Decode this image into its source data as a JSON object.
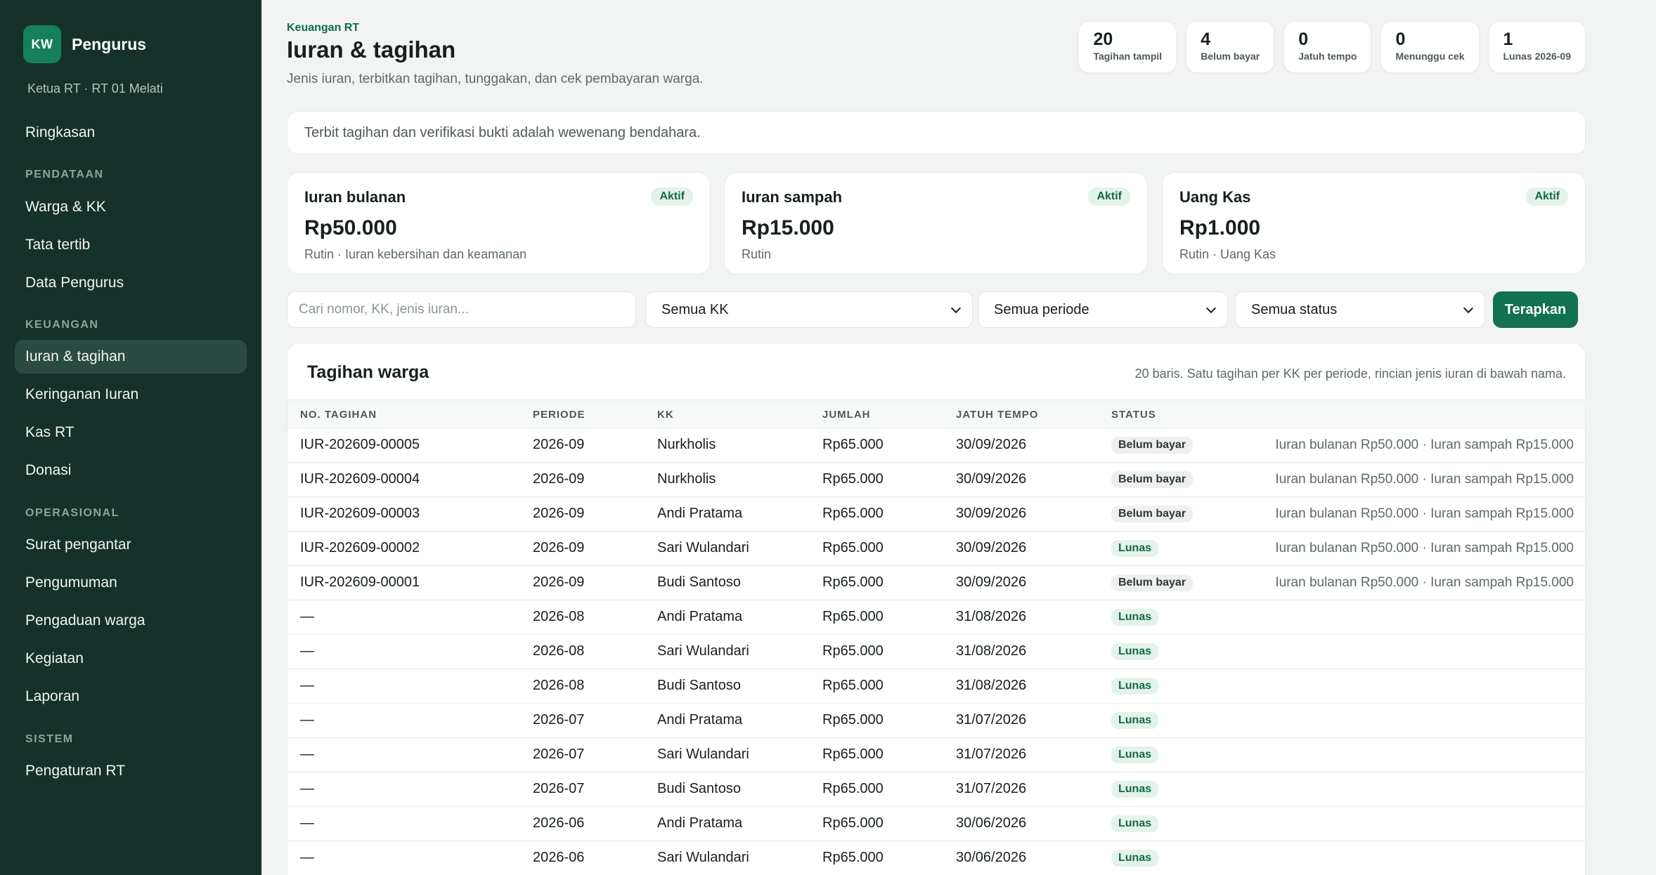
{
  "sidebar": {
    "brand_initials": "KW",
    "brand_name": "Pengurus",
    "role": "Ketua RT · RT 01 Melati",
    "summary": "Ringkasan",
    "sections": {
      "data": "PENDATAAN",
      "finance": "KEUANGAN",
      "ops": "OPERASIONAL",
      "system": "SISTEM"
    },
    "items": {
      "warga": "Warga & KK",
      "tata_tertib": "Tata tertib",
      "data_pengurus": "Data Pengurus",
      "iuran": "Iuran & tagihan",
      "keringanan": "Keringanan Iuran",
      "kas": "Kas RT",
      "donasi": "Donasi",
      "surat": "Surat pengantar",
      "pengumuman": "Pengumuman",
      "pengaduan": "Pengaduan warga",
      "kegiatan": "Kegiatan",
      "laporan": "Laporan",
      "pengaturan": "Pengaturan RT"
    }
  },
  "header": {
    "eyebrow": "Keuangan RT",
    "title": "Iuran & tagihan",
    "subtitle": "Jenis iuran, terbitkan tagihan, tunggakan, dan cek pembayaran warga."
  },
  "stats": [
    {
      "value": "20",
      "label": "Tagihan tampil"
    },
    {
      "value": "4",
      "label": "Belum bayar"
    },
    {
      "value": "0",
      "label": "Jatuh tempo"
    },
    {
      "value": "0",
      "label": "Menunggu cek"
    },
    {
      "value": "1",
      "label": "Lunas 2026-09"
    }
  ],
  "notice": "Terbit tagihan dan verifikasi bukti adalah wewenang bendahara.",
  "fee_types": [
    {
      "name": "Iuran bulanan",
      "badge": "Aktif",
      "amount": "Rp50.000",
      "desc": "Rutin · Iuran kebersihan dan keamanan"
    },
    {
      "name": "Iuran sampah",
      "badge": "Aktif",
      "amount": "Rp15.000",
      "desc": "Rutin"
    },
    {
      "name": "Uang Kas",
      "badge": "Aktif",
      "amount": "Rp1.000",
      "desc": "Rutin · Uang Kas"
    }
  ],
  "filters": {
    "search_placeholder": "Cari nomor, KK, jenis iuran...",
    "kk": "Semua KK",
    "period": "Semua periode",
    "status": "Semua status",
    "apply": "Terapkan"
  },
  "table": {
    "title": "Tagihan warga",
    "note": "20 baris. Satu tagihan per KK per periode, rincian jenis iuran di bawah nama.",
    "columns": [
      "NO. TAGIHAN",
      "PERIODE",
      "KK",
      "JUMLAH",
      "JATUH TEMPO",
      "STATUS"
    ],
    "rows": [
      {
        "no": "IUR-202609-00005",
        "period": "2026-09",
        "kk": "Nurkholis",
        "amount": "Rp65.000",
        "due": "30/09/2026",
        "status": "Belum bayar",
        "paid": false,
        "detail": "Iuran bulanan Rp50.000 · Iuran sampah Rp15.000"
      },
      {
        "no": "IUR-202609-00004",
        "period": "2026-09",
        "kk": "Nurkholis",
        "amount": "Rp65.000",
        "due": "30/09/2026",
        "status": "Belum bayar",
        "paid": false,
        "detail": "Iuran bulanan Rp50.000 · Iuran sampah Rp15.000"
      },
      {
        "no": "IUR-202609-00003",
        "period": "2026-09",
        "kk": "Andi Pratama",
        "amount": "Rp65.000",
        "due": "30/09/2026",
        "status": "Belum bayar",
        "paid": false,
        "detail": "Iuran bulanan Rp50.000 · Iuran sampah Rp15.000"
      },
      {
        "no": "IUR-202609-00002",
        "period": "2026-09",
        "kk": "Sari Wulandari",
        "amount": "Rp65.000",
        "due": "30/09/2026",
        "status": "Lunas",
        "paid": true,
        "detail": "Iuran bulanan Rp50.000 · Iuran sampah Rp15.000"
      },
      {
        "no": "IUR-202609-00001",
        "period": "2026-09",
        "kk": "Budi Santoso",
        "amount": "Rp65.000",
        "due": "30/09/2026",
        "status": "Belum bayar",
        "paid": false,
        "detail": "Iuran bulanan Rp50.000 · Iuran sampah Rp15.000"
      },
      {
        "no": "—",
        "period": "2026-08",
        "kk": "Andi Pratama",
        "amount": "Rp65.000",
        "due": "31/08/2026",
        "status": "Lunas",
        "paid": true,
        "detail": ""
      },
      {
        "no": "—",
        "period": "2026-08",
        "kk": "Sari Wulandari",
        "amount": "Rp65.000",
        "due": "31/08/2026",
        "status": "Lunas",
        "paid": true,
        "detail": ""
      },
      {
        "no": "—",
        "period": "2026-08",
        "kk": "Budi Santoso",
        "amount": "Rp65.000",
        "due": "31/08/2026",
        "status": "Lunas",
        "paid": true,
        "detail": ""
      },
      {
        "no": "—",
        "period": "2026-07",
        "kk": "Andi Pratama",
        "amount": "Rp65.000",
        "due": "31/07/2026",
        "status": "Lunas",
        "paid": true,
        "detail": ""
      },
      {
        "no": "—",
        "period": "2026-07",
        "kk": "Sari Wulandari",
        "amount": "Rp65.000",
        "due": "31/07/2026",
        "status": "Lunas",
        "paid": true,
        "detail": ""
      },
      {
        "no": "—",
        "period": "2026-07",
        "kk": "Budi Santoso",
        "amount": "Rp65.000",
        "due": "31/07/2026",
        "status": "Lunas",
        "paid": true,
        "detail": ""
      },
      {
        "no": "—",
        "period": "2026-06",
        "kk": "Andi Pratama",
        "amount": "Rp65.000",
        "due": "30/06/2026",
        "status": "Lunas",
        "paid": true,
        "detail": ""
      },
      {
        "no": "—",
        "period": "2026-06",
        "kk": "Sari Wulandari",
        "amount": "Rp65.000",
        "due": "30/06/2026",
        "status": "Lunas",
        "paid": true,
        "detail": ""
      }
    ]
  }
}
